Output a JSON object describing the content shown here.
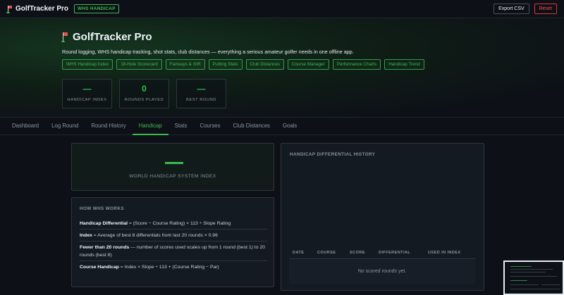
{
  "app": {
    "title": "GolfTracker Pro",
    "badge": "WHS HANDICAP"
  },
  "top_actions": {
    "export_label": "Export CSV",
    "reset_label": "Reset"
  },
  "hero": {
    "title": "GolfTracker Pro",
    "subtitle": "Round logging, WHS handicap tracking, shot stats, club distances — everything a serious amateur golfer needs in one offline app.",
    "chips": [
      "WHS Handicap Index",
      "18-Hole Scorecard",
      "Fairways & GIR",
      "Putting Stats",
      "Club Distances",
      "Course Manager",
      "Performance Charts",
      "Handicap Trend"
    ],
    "stats": [
      {
        "value": "—",
        "label": "HANDICAP INDEX"
      },
      {
        "value": "0",
        "label": "ROUNDS PLAYED"
      },
      {
        "value": "—",
        "label": "BEST ROUND"
      }
    ]
  },
  "nav": {
    "tabs": [
      "Dashboard",
      "Log Round",
      "Round History",
      "Handicap",
      "Stats",
      "Courses",
      "Club Distances",
      "Goals"
    ],
    "active": "Handicap"
  },
  "handicap": {
    "index_label": "WORLD HANDICAP SYSTEM INDEX"
  },
  "how_whs_works": {
    "heading": "HOW WHS WORKS",
    "rows": [
      {
        "term": "Handicap Differential",
        "text": " = (Score − Course Rating) × 113 ÷ Slope Rating"
      },
      {
        "term": "Index",
        "text": " = Average of best 8 differentials from last 20 rounds × 0.96"
      },
      {
        "term": "Fewer than 20 rounds",
        "text": " — number of scores used scales up from 1 round (best 1) to 20 rounds (best 8)"
      },
      {
        "term": "Course Handicap",
        "text": " = Index × Slope ÷ 113 + (Course Rating − Par)"
      }
    ]
  },
  "history": {
    "heading": "HANDICAP DIFFERENTIAL HISTORY",
    "columns": [
      "DATE",
      "COURSE",
      "SCORE",
      "DIFFERENTIAL",
      "USED IN INDEX"
    ],
    "empty_text": "No scored rounds yet."
  },
  "colors": {
    "accent": "#3fb950",
    "danger": "#f85149",
    "background": "#0d1117",
    "panel": "#131a22"
  },
  "icons": {
    "brand": "golf-flag-icon"
  }
}
